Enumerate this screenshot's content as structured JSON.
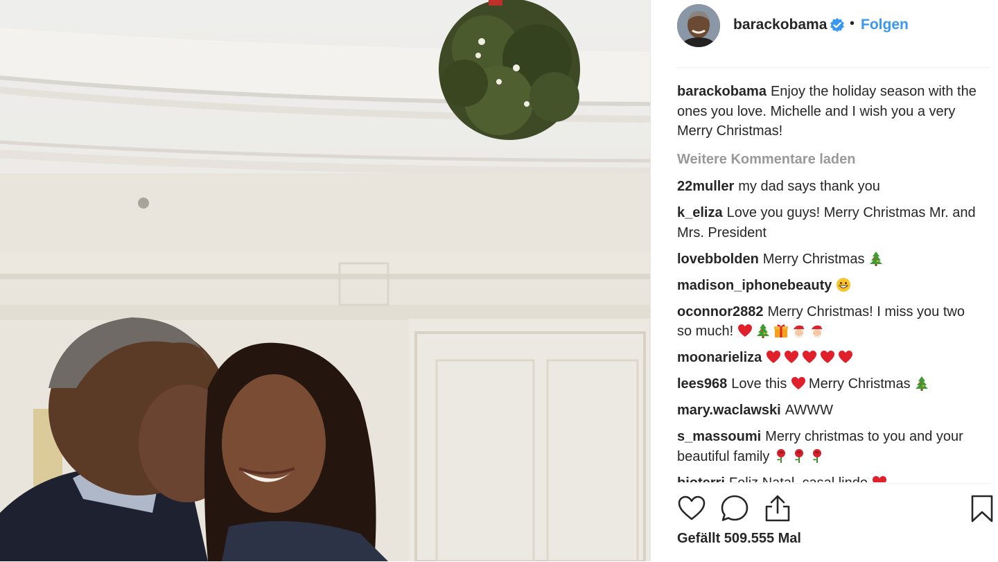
{
  "post": {
    "username": "barackobama",
    "follow_label": "Folgen",
    "separator": "•",
    "caption": "Enjoy the holiday season with the ones you love. Michelle and I wish you a very Merry Christmas!",
    "load_more_label": "Weitere Kommentare laden",
    "likes_label": "Gefällt 509.555 Mal",
    "accent_color": "#3897f0",
    "comments": [
      {
        "user": "22muller",
        "text": "my dad says thank you",
        "emojis": []
      },
      {
        "user": "k_eliza",
        "text": "Love you guys! Merry Christmas Mr. and Mrs. President",
        "emojis": []
      },
      {
        "user": "lovebbolden",
        "text": "Merry Christmas",
        "emojis": [
          "tree"
        ]
      },
      {
        "user": "madison_iphonebeauty",
        "text": "",
        "emojis": [
          "grin"
        ]
      },
      {
        "user": "oconnor2882",
        "text": "Merry Christmas! I miss you two so much!",
        "emojis": [
          "heart",
          "tree",
          "gift",
          "santa",
          "santa"
        ]
      },
      {
        "user": "moonarieliza",
        "text": "",
        "emojis": [
          "heart",
          "heart",
          "heart",
          "heart",
          "heart"
        ]
      },
      {
        "user": "lees968",
        "text": "Love this",
        "emojis": [
          "heart"
        ],
        "text2": "Merry Christmas",
        "emojis2": [
          "tree"
        ]
      },
      {
        "user": "mary.waclawski",
        "text": "AWWW",
        "emojis": []
      },
      {
        "user": "s_massoumi",
        "text": "Merry christmas to you and your beautiful family",
        "emojis": [
          "rose",
          "rose",
          "rose"
        ]
      },
      {
        "user": "bioterri",
        "text": "Feliz Natal, casal lindo",
        "emojis": [
          "heart"
        ]
      }
    ]
  },
  "icons": {
    "verified": "verified-badge-icon",
    "like": "heart-outline-icon",
    "comment": "comment-bubble-icon",
    "share": "share-icon",
    "save": "bookmark-icon"
  }
}
